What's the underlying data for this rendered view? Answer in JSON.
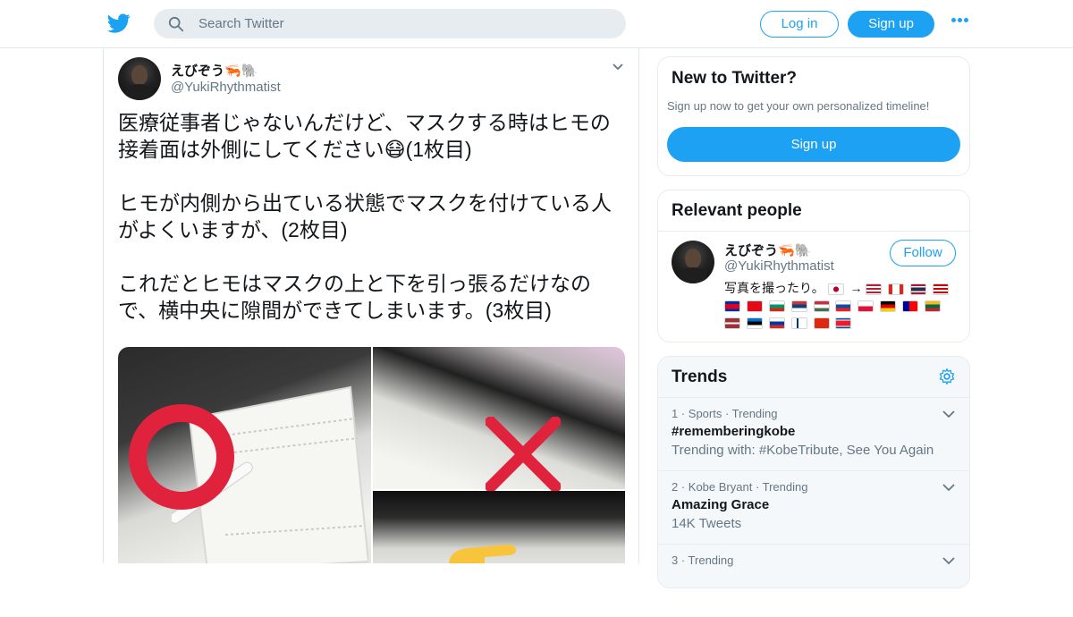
{
  "header": {
    "search_placeholder": "Search Twitter",
    "login_label": "Log in",
    "signup_label": "Sign up"
  },
  "tweet": {
    "author_name": "えびぞう🦐🐘",
    "author_handle": "@YukiRhythmatist",
    "paragraphs": [
      "医療従事者じゃないんだけど、マスクする時はヒモの接着面は外側にしてください😷(1枚目)",
      "ヒモが内側から出ている状態でマスクを付けている人がよくいますが、(2枚目)",
      "これだとヒモはマスクの上と下を引っ張るだけなので、横中央に隙間ができてしまいます。(3枚目)"
    ]
  },
  "sidebar": {
    "new_to_twitter": {
      "title": "New to Twitter?",
      "subtitle": "Sign up now to get your own personalized timeline!",
      "button": "Sign up"
    },
    "relevant_people": {
      "title": "Relevant people",
      "name": "えびぞう🦐🐘",
      "handle": "@YukiRhythmatist",
      "follow_label": "Follow",
      "bio": "写真を撮ったり。"
    },
    "trends": {
      "title": "Trends",
      "items": [
        {
          "meta": "1 · Sports · Trending",
          "name": "#rememberingkobe",
          "extra": "Trending with: #KobeTribute, See You Again"
        },
        {
          "meta": "2 · Kobe Bryant · Trending",
          "name": "Amazing Grace",
          "extra": "14K Tweets"
        },
        {
          "meta": "3 · Trending",
          "name": "",
          "extra": ""
        }
      ]
    }
  },
  "colors": {
    "accent": "#1da1f2",
    "text_primary": "#14171a",
    "text_secondary": "#657786",
    "border": "#e6ecf0",
    "mark_red": "#e0223d"
  }
}
